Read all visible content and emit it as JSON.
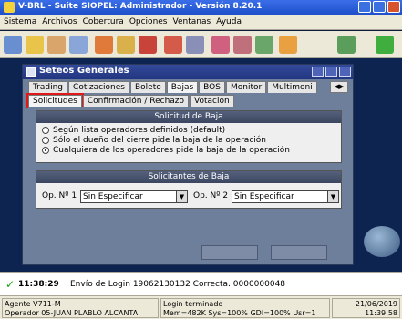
{
  "window": {
    "title": "V-BRL - Suite SIOPEL: Administrador - Versión 8.20.1"
  },
  "menu": [
    "Sistema",
    "Archivos",
    "Cobertura",
    "Opciones",
    "Ventanas",
    "Ayuda"
  ],
  "toolbar": {
    "icons": [
      "users-icon",
      "globe-icon",
      "group-icon",
      "edit-icon",
      "chart-icon",
      "people-icon",
      "person-icon",
      "monitor-icon",
      "team-icon",
      "people-alt-icon",
      "people-green-icon",
      "group-orange-icon",
      "settings-icon",
      "language-en-icon",
      "exit-icon"
    ]
  },
  "dialog": {
    "title": "Seteos Generales",
    "tabs_row1": [
      "Trading",
      "Cotizaciones",
      "Boleto",
      "Bajas",
      "BOS",
      "Monitor",
      "Multimoni"
    ],
    "active_tab_row1": "Bajas",
    "tabs_row2": [
      "Solicitudes",
      "Confirmación / Rechazo",
      "Votacion"
    ],
    "active_tab_row2": "Solicitudes",
    "group_baja": {
      "title": "Solicitud de Baja",
      "options": [
        "Según lista operadores definidos (default)",
        "Sólo el dueño del cierre pide la baja de la operación",
        "Cualquiera de los operadores pide la baja de la operación"
      ],
      "selected_index": 2
    },
    "group_solicitantes": {
      "title": "Solicitantes de Baja",
      "op1_label": "Op. Nº 1",
      "op1_value": "Sin Especificar",
      "op2_label": "Op. Nº 2",
      "op2_value": "Sin Especificar"
    }
  },
  "log": {
    "time": "11:38:29",
    "message": "Envío de Login 19062130132 Correcta. 0000000048"
  },
  "status": {
    "agent": "Agente V711-M",
    "operator": "Operador 05-JUAN PLABLO ALCANTA",
    "login": "Login terminado",
    "mem": "Mem=482K Sys=100% GDI=100% Usr=1",
    "date": "21/06/2019",
    "time": "11:39:58"
  },
  "colors": {
    "accent_blue": "#1f4fc9",
    "highlight_red": "#e01818",
    "success_green": "#17a117"
  }
}
